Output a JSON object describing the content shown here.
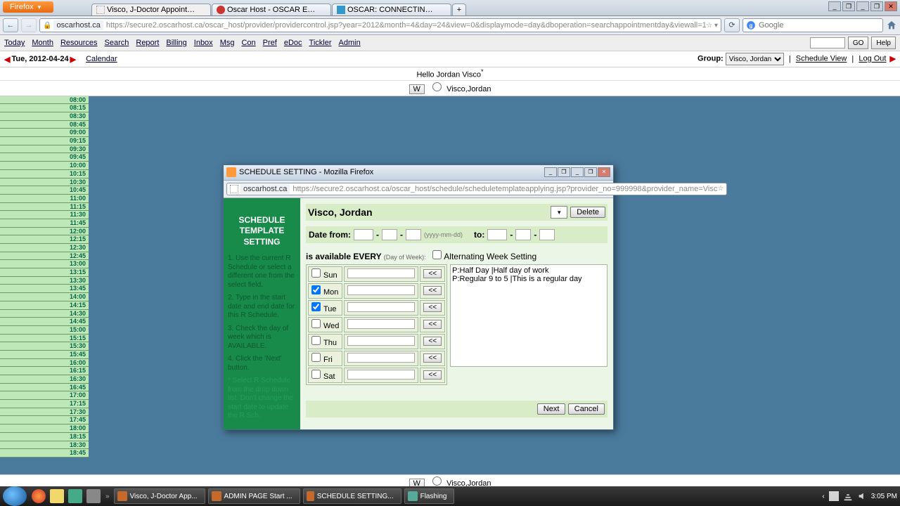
{
  "firefox_button": "Firefox",
  "tabs": [
    {
      "label": "Visco, J-Doctor Appointment Access ..."
    },
    {
      "label": "Oscar Host - OSCAR Electronic Medic..."
    },
    {
      "label": "OSCAR: CONNECTING CARE, CREATI..."
    }
  ],
  "url_host": "oscarhost.ca",
  "url_path": "https://secure2.oscarhost.ca/oscar_host/provider/providercontrol.jsp?year=2012&month=4&day=24&view=0&displaymode=day&dboperation=searchappointmentday&viewall=1",
  "search_placeholder": "Google",
  "app_menu": [
    "Today",
    "Month",
    "Resources",
    "Search",
    "Report",
    "Billing",
    "Inbox",
    "Msg",
    "Con",
    "Pref",
    "eDoc",
    "Tickler",
    "Admin"
  ],
  "go_btn": "GO",
  "help_btn": "Help",
  "date_label": "Tue, 2012-04-24",
  "calendar_link": "Calendar",
  "group_label": "Group:",
  "group_value": "Visco, Jordan",
  "schedule_view": "Schedule View",
  "logout": "Log Out",
  "hello": "Hello Jordan Visco",
  "prov_w": "W",
  "prov_name_row": "Visco,Jordan",
  "times": [
    "08:00",
    "08:15",
    "08:30",
    "08:45",
    "09:00",
    "09:15",
    "09:30",
    "09:45",
    "10:00",
    "10:15",
    "10:30",
    "10:45",
    "11:00",
    "11:15",
    "11:30",
    "11:45",
    "12:00",
    "12:15",
    "12:30",
    "12:45",
    "13:00",
    "13:15",
    "13:30",
    "13:45",
    "14:00",
    "14:15",
    "14:30",
    "14:45",
    "15:00",
    "15:15",
    "15:30",
    "15:45",
    "16:00",
    "16:15",
    "16:30",
    "16:45",
    "17:00",
    "17:15",
    "17:30",
    "17:45",
    "18:00",
    "18:15",
    "18:30",
    "18:45"
  ],
  "popup": {
    "title": "SCHEDULE SETTING - Mozilla Firefox",
    "url_host": "oscarhost.ca",
    "url_path": "https://secure2.oscarhost.ca/oscar_host/schedule/scheduletemplateapplying.jsp?provider_no=999998&provider_name=Visc",
    "sidebar_title": "SCHEDULE TEMPLATE SETTING",
    "steps": [
      "1. Use the current R Schedule or select a different one from the select field.",
      "2. Type in the start date and end date for this R Schedule.",
      "3. Check the day of week which is AVAILABLE.",
      "4. Click the 'Next' button.",
      "* Select R Schedule from the drop down list. Don't change the start date to update the R Sch."
    ],
    "provider_name": "Visco, Jordan",
    "delete_btn": "Delete",
    "date_from": "Date from:",
    "date_hint": "(yyyy-mm-dd)",
    "to_label": "to:",
    "avail_label": "is available EVERY",
    "dow_hint": "(Day of Week):",
    "alt_week": "Alternating Week Setting",
    "days": [
      {
        "label": "Sun",
        "checked": false
      },
      {
        "label": "Mon",
        "checked": true
      },
      {
        "label": "Tue",
        "checked": true
      },
      {
        "label": "Wed",
        "checked": false
      },
      {
        "label": "Thu",
        "checked": false
      },
      {
        "label": "Fri",
        "checked": false
      },
      {
        "label": "Sat",
        "checked": false
      }
    ],
    "apply_btn": "<<",
    "templates": [
      "P:Half Day |Half day of work",
      "P:Regular 9 to 5 |This is a regular day"
    ],
    "next_btn": "Next",
    "cancel_btn": "Cancel"
  },
  "taskbar": {
    "tasks": [
      "Visco, J-Doctor App...",
      "ADMIN PAGE Start ...",
      "SCHEDULE SETTING...",
      "Flashing"
    ],
    "time": "3:05 PM"
  }
}
